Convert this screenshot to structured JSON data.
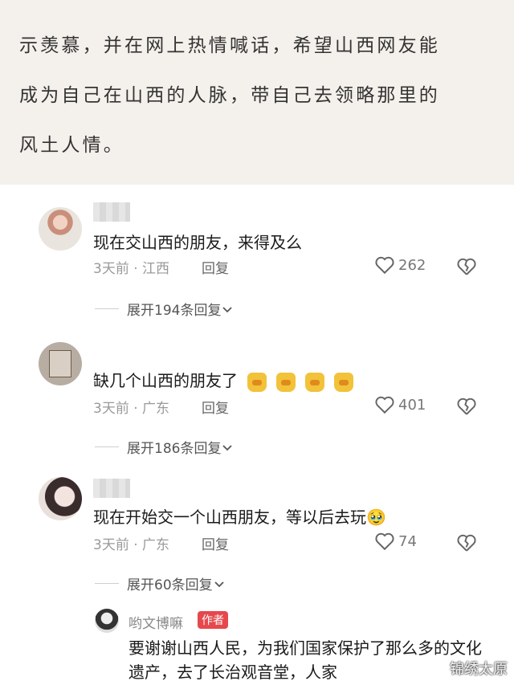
{
  "article": {
    "lines": [
      "示羡慕，并在网上热情喊话，希望山西网友能",
      "成为自己在山西的人脉，带自己去领略那里的",
      "风土人情。"
    ]
  },
  "comments": [
    {
      "text": "现在交山西的朋友，来得及么",
      "meta": "3天前 · 江西",
      "reply_label": "回复",
      "likes": "262",
      "expand": "展开194条回复"
    },
    {
      "text": "缺几个山西的朋友了",
      "meta": "3天前 · 广东",
      "reply_label": "回复",
      "likes": "401",
      "expand": "展开186条回复"
    },
    {
      "text": "现在开始交一个山西朋友，等以后去玩🥹",
      "meta": "3天前 · 广东",
      "reply_label": "回复",
      "likes": "74",
      "expand": "展开60条回复"
    }
  ],
  "author_reply": {
    "name": "哟文博嘛",
    "badge": "作者",
    "text": "要谢谢山西人民，为我们国家保护了那么多的文化遗产，去了长治观音堂，人家"
  },
  "watermark": "锦绣太原",
  "icons": {
    "like": "heart-outline-icon",
    "dislike": "broken-heart-icon",
    "expand": "chevron-down-icon"
  }
}
